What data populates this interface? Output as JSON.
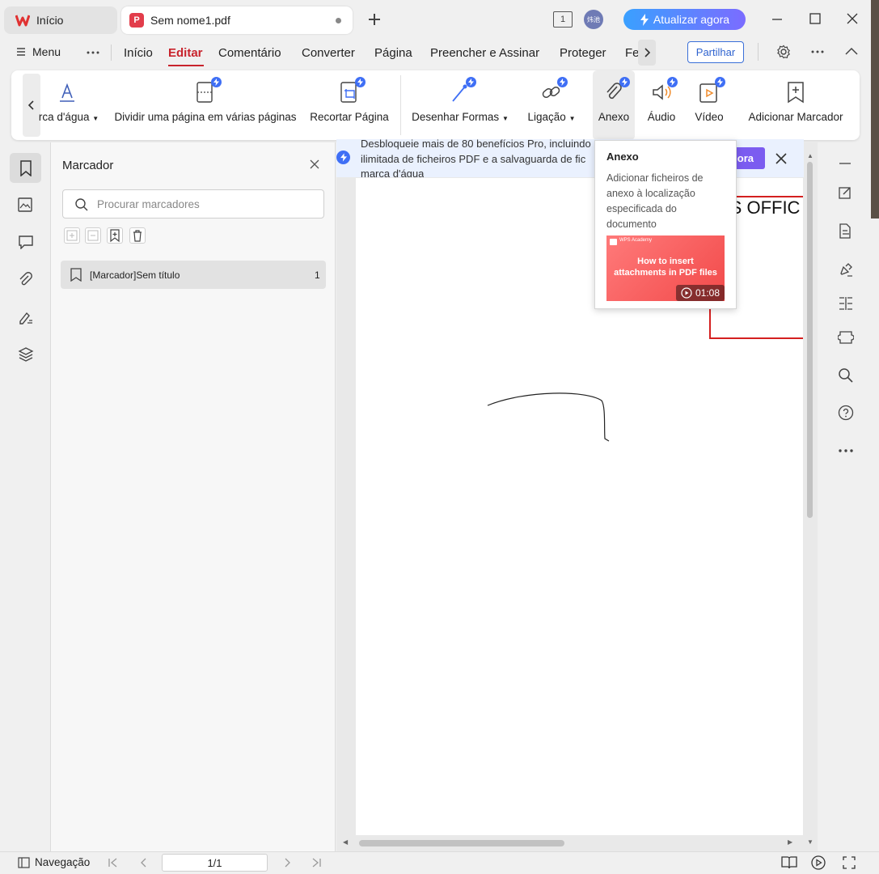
{
  "titlebar": {
    "home_tab": "Início",
    "doc_tab": "Sem nome1.pdf",
    "pdf_glyph": "P",
    "window_count": "1",
    "avatar_text": "炜池",
    "upgrade": "Atualizar agora"
  },
  "menubar": {
    "menu": "Menu",
    "tabs": [
      "Início",
      "Editar",
      "Comentário",
      "Converter",
      "Página",
      "Preencher e Assinar",
      "Proteger",
      "Fe"
    ],
    "share": "Partilhar"
  },
  "ribbon": {
    "items": [
      {
        "label": "rca d'água",
        "icon": "watermark-icon",
        "dropdown": true
      },
      {
        "label": "Dividir uma página em várias páginas",
        "icon": "split-page-icon"
      },
      {
        "label": "Recortar Página",
        "icon": "crop-page-icon"
      },
      {
        "label": "Desenhar Formas",
        "icon": "draw-shapes-icon",
        "dropdown": true
      },
      {
        "label": "Ligação",
        "icon": "link-icon",
        "dropdown": true
      },
      {
        "label": "Anexo",
        "icon": "paperclip-icon"
      },
      {
        "label": "Áudio",
        "icon": "audio-icon"
      },
      {
        "label": "Vídeo",
        "icon": "video-icon"
      },
      {
        "label": "Adicionar Marcador",
        "icon": "add-bookmark-icon"
      }
    ]
  },
  "bookmark_panel": {
    "title": "Marcador",
    "search_placeholder": "Procurar marcadores",
    "items": [
      {
        "label": "[Marcador]Sem título",
        "page": "1"
      }
    ]
  },
  "banner": {
    "line1": "Desbloqueie mais de 80 benefícios Pro, incluindo",
    "line2": "ilimitada de ficheiros PDF e a salvaguarda de fic",
    "line3": "marca d'água",
    "button": "ora"
  },
  "document": {
    "header_text": "PS OFFIC"
  },
  "tooltip": {
    "title": "Anexo",
    "description": "Adicionar ficheiros de anexo à localização especificada do documento",
    "video_brand": "WPS Academy",
    "video_title": "How to insert attachments in PDF files",
    "video_duration": "01:08"
  },
  "statusbar": {
    "navigation": "Navegação",
    "page": "1/1"
  },
  "colors": {
    "accent": "#c8232c",
    "upgrade_start": "#3aa0ff",
    "upgrade_end": "#7b6cff",
    "pro_badge": "#3f6ff5"
  }
}
